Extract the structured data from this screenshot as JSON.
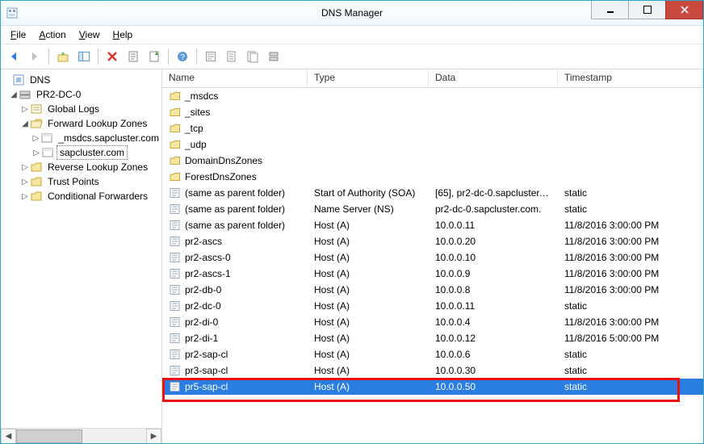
{
  "window": {
    "title": "DNS Manager"
  },
  "menu": {
    "file": "File",
    "action": "Action",
    "view": "View",
    "help": "Help"
  },
  "tree": {
    "root": "DNS",
    "server": "PR2-DC-0",
    "globalLogs": "Global Logs",
    "fwdZones": "Forward Lookup Zones",
    "zone1": "_msdcs.sapcluster.com",
    "zone2": "sapcluster.com",
    "revZones": "Reverse Lookup Zones",
    "trustPoints": "Trust Points",
    "condFwd": "Conditional Forwarders"
  },
  "columns": {
    "name": "Name",
    "type": "Type",
    "data": "Data",
    "ts": "Timestamp"
  },
  "folders": [
    {
      "name": "_msdcs"
    },
    {
      "name": "_sites"
    },
    {
      "name": "_tcp"
    },
    {
      "name": "_udp"
    },
    {
      "name": "DomainDnsZones"
    },
    {
      "name": "ForestDnsZones"
    }
  ],
  "records": [
    {
      "name": "(same as parent folder)",
      "type": "Start of Authority (SOA)",
      "data": "[65], pr2-dc-0.sapcluster.c...",
      "ts": "static"
    },
    {
      "name": "(same as parent folder)",
      "type": "Name Server (NS)",
      "data": "pr2-dc-0.sapcluster.com.",
      "ts": "static"
    },
    {
      "name": "(same as parent folder)",
      "type": "Host (A)",
      "data": "10.0.0.11",
      "ts": "11/8/2016 3:00:00 PM"
    },
    {
      "name": "pr2-ascs",
      "type": "Host (A)",
      "data": "10.0.0.20",
      "ts": "11/8/2016 3:00:00 PM"
    },
    {
      "name": "pr2-ascs-0",
      "type": "Host (A)",
      "data": "10.0.0.10",
      "ts": "11/8/2016 3:00:00 PM"
    },
    {
      "name": "pr2-ascs-1",
      "type": "Host (A)",
      "data": "10.0.0.9",
      "ts": "11/8/2016 3:00:00 PM"
    },
    {
      "name": "pr2-db-0",
      "type": "Host (A)",
      "data": "10.0.0.8",
      "ts": "11/8/2016 3:00:00 PM"
    },
    {
      "name": "pr2-dc-0",
      "type": "Host (A)",
      "data": "10.0.0.11",
      "ts": "static"
    },
    {
      "name": "pr2-di-0",
      "type": "Host (A)",
      "data": "10.0.0.4",
      "ts": "11/8/2016 3:00:00 PM"
    },
    {
      "name": "pr2-di-1",
      "type": "Host (A)",
      "data": "10.0.0.12",
      "ts": "11/8/2016 5:00:00 PM"
    },
    {
      "name": "pr2-sap-cl",
      "type": "Host (A)",
      "data": "10.0.0.6",
      "ts": "static"
    },
    {
      "name": "pr3-sap-cl",
      "type": "Host (A)",
      "data": "10.0.0.30",
      "ts": "static"
    },
    {
      "name": "pr5-sap-cl",
      "type": "Host (A)",
      "data": "10.0.0.50",
      "ts": "static",
      "selected": true
    }
  ]
}
